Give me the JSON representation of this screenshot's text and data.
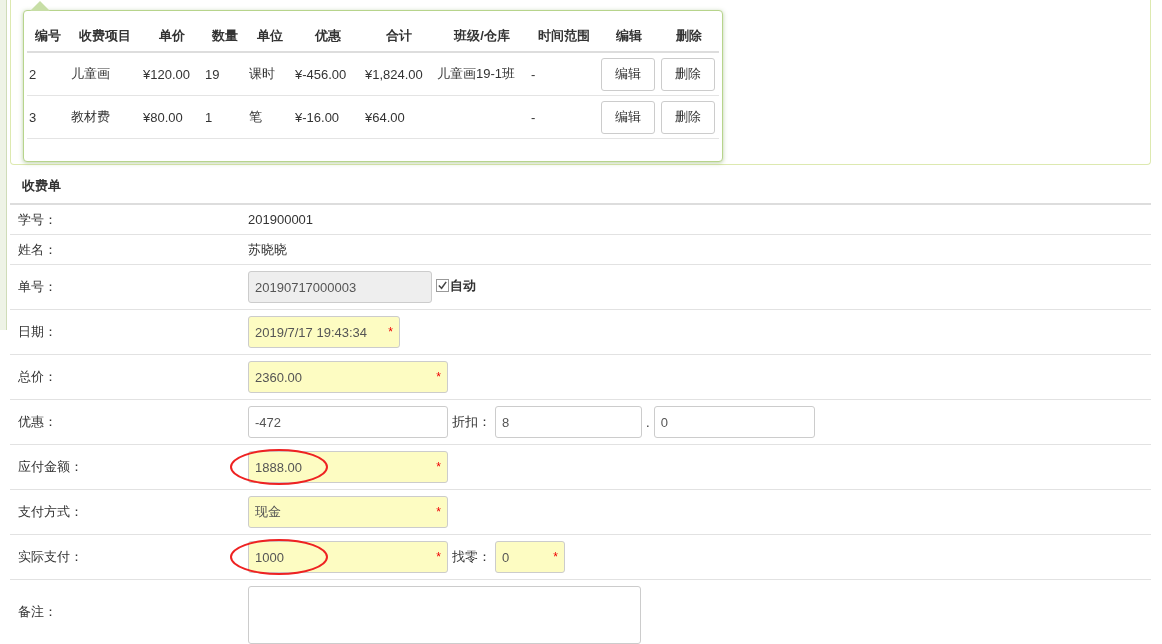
{
  "popup_table": {
    "columns": [
      "编号",
      "收费项目",
      "单价",
      "数量",
      "单位",
      "优惠",
      "合计",
      "班级/仓库",
      "时间范围",
      "编辑",
      "删除"
    ],
    "rows": [
      {
        "cells": [
          "2",
          "儿童画",
          "¥120.00",
          "19",
          "课时",
          "¥-456.00",
          "¥1,824.00",
          "儿童画19-1班",
          "-"
        ],
        "edit_button": "编辑",
        "delete_button": "删除"
      },
      {
        "cells": [
          "3",
          "教材费",
          "¥80.00",
          "1",
          "笔",
          "¥-16.00",
          "¥64.00",
          "",
          "-"
        ],
        "edit_button": "编辑",
        "delete_button": "删除"
      }
    ]
  },
  "form": {
    "title": "收费单",
    "rows": [
      {
        "label": "学号：",
        "kind": "text",
        "value": "201900001"
      },
      {
        "label": "姓名：",
        "kind": "text",
        "value": "苏晓晓"
      },
      {
        "label": "单号：",
        "kind": "fields",
        "fields": [
          {
            "kind": "code",
            "value": "20190717000003",
            "disabled": true
          }
        ],
        "checkbox": {
          "label": "自动",
          "checked": true
        }
      },
      {
        "label": "日期：",
        "kind": "fields",
        "fields": [
          {
            "kind": "date",
            "value": "2019/7/17 19:43:34",
            "required_mark": "*"
          }
        ]
      },
      {
        "label": "总价：",
        "kind": "fields",
        "fields": [
          {
            "kind": "wide",
            "value": "2360.00",
            "required_mark": "*"
          }
        ]
      },
      {
        "label": "优惠：",
        "kind": "fields",
        "fields": [
          {
            "kind": "wide",
            "value": "-472"
          },
          {
            "kind": "split",
            "prefix": "折扣：",
            "value": "8"
          },
          {
            "kind": "split-wide",
            "prefix": ".",
            "value": "0"
          }
        ]
      },
      {
        "label": "应付金额：",
        "kind": "fields",
        "fields": [
          {
            "kind": "wide",
            "value": "1888.00",
            "required_mark": "*",
            "circled": true
          }
        ]
      },
      {
        "label": "支付方式：",
        "kind": "fields",
        "fields": [
          {
            "kind": "wide",
            "value": "现金",
            "required_mark": "*"
          }
        ]
      },
      {
        "label": "实际支付：",
        "kind": "fields",
        "fields": [
          {
            "kind": "wide",
            "value": "1000",
            "required_mark": "*",
            "circled": true
          },
          {
            "kind": "short",
            "prefix": "找零：",
            "value": "0",
            "required_mark": "*"
          }
        ]
      },
      {
        "label": "备注：",
        "kind": "textarea",
        "value": ""
      }
    ]
  }
}
